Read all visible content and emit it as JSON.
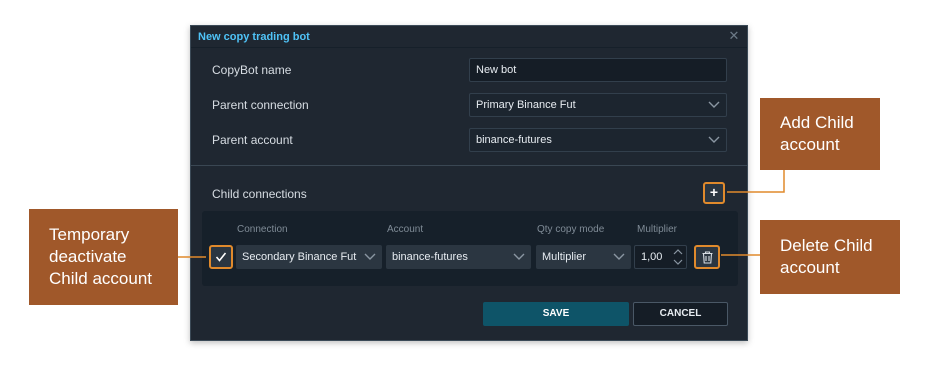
{
  "dialog": {
    "title": "New copy trading bot",
    "close_icon": "close-icon",
    "title_color": "#4fc3f7",
    "fields": {
      "copybot_name_label": "CopyBot name",
      "copybot_name_value": "New bot",
      "parent_connection_label": "Parent connection",
      "parent_connection_value": "Primary Binance Fut",
      "parent_account_label": "Parent account",
      "parent_account_value": "binance-futures"
    },
    "child_connections": {
      "label": "Child connections",
      "add_icon": "plus-icon",
      "columns": {
        "connection": "Connection",
        "account": "Account",
        "qty_copy_mode": "Qty copy mode",
        "multiplier": "Multiplier"
      },
      "rows": [
        {
          "enabled": true,
          "connection": "Secondary Binance Fut",
          "account": "binance-futures",
          "qty_copy_mode": "Multiplier",
          "multiplier": "1,00"
        }
      ]
    },
    "buttons": {
      "save": "SAVE",
      "cancel": "CANCEL"
    }
  },
  "callouts": {
    "add_child": "Add Child account",
    "delete_child": "Delete Child account",
    "deactivate": "Temporary deactivate Child account"
  },
  "colors": {
    "accent_highlight": "#e08a2c",
    "callout_bg": "#a0582a",
    "save_button": "#0e5468",
    "dialog_bg": "#1f2731"
  }
}
